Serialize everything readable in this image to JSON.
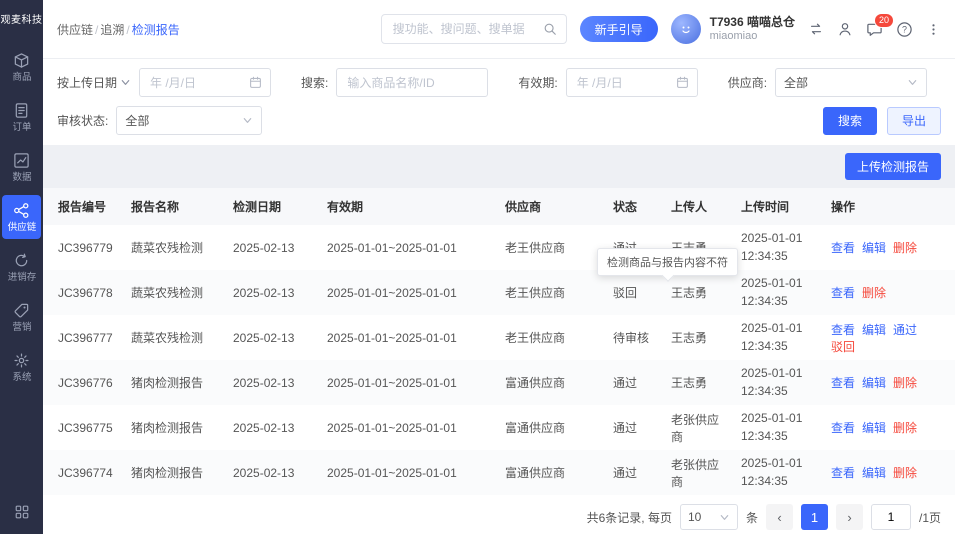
{
  "brand": {
    "logo": "观麦科技"
  },
  "colors": {
    "accent": "#3a66fb",
    "danger": "#f5483b",
    "sidebar_bg": "#2a2f45"
  },
  "sidebar": {
    "items": [
      {
        "name": "goods",
        "icon": "box",
        "label": "商品",
        "active": false
      },
      {
        "name": "orders",
        "icon": "file",
        "label": "订单",
        "active": false
      },
      {
        "name": "data",
        "icon": "chart",
        "label": "数据",
        "active": false
      },
      {
        "name": "supply-chain",
        "icon": "nodes",
        "label": "供应链",
        "active": true
      },
      {
        "name": "inventory",
        "icon": "cycle",
        "label": "进销存",
        "active": false
      },
      {
        "name": "marketing",
        "icon": "tag",
        "label": "营销",
        "active": false
      },
      {
        "name": "system",
        "icon": "gear",
        "label": "系统",
        "active": false
      }
    ]
  },
  "header": {
    "breadcrumb": [
      "供应链",
      "追溯",
      "检测报告"
    ],
    "search_placeholder": "搜功能、搜问题、搜单据",
    "guide_button": "新手引导",
    "account_name": "T7936 喵喵总仓",
    "account_sub": "miaomiao",
    "message_badge": "20"
  },
  "filters": {
    "date_field_label": "按上传日期",
    "date_placeholder": "年 /月/日",
    "search_label": "搜索:",
    "search_placeholder": "输入商品名称/ID",
    "validity_label": "有效期:",
    "validity_placeholder": "年 /月/日",
    "supplier_label": "供应商:",
    "supplier_value": "全部",
    "status_label": "审核状态:",
    "status_value": "全部",
    "search_button": "搜索",
    "export_button": "导出"
  },
  "toolbar": {
    "upload_button": "上传检测报告"
  },
  "tooltip": {
    "text": "检测商品与报告内容不符"
  },
  "table": {
    "headers": [
      "报告编号",
      "报告名称",
      "检测日期",
      "有效期",
      "供应商",
      "状态",
      "上传人",
      "上传时间",
      "操作"
    ],
    "rows": [
      {
        "id": "JC396779",
        "name": "蔬菜农残检测",
        "test_date": "2025-02-13",
        "validity": "2025-01-01~2025-01-01",
        "supplier": "老王供应商",
        "status": "通过",
        "uploader": "王志勇",
        "upload_time": "2025-01-01 12:34:35",
        "actions": [
          {
            "name": "view",
            "label": "查看",
            "type": "primary"
          },
          {
            "name": "edit",
            "label": "编辑",
            "type": "primary"
          },
          {
            "name": "delete",
            "label": "删除",
            "type": "danger"
          }
        ]
      },
      {
        "id": "JC396778",
        "name": "蔬菜农残检测",
        "test_date": "2025-02-13",
        "validity": "2025-01-01~2025-01-01",
        "supplier": "老王供应商",
        "status": "驳回",
        "uploader": "王志勇",
        "upload_time": "2025-01-01 12:34:35",
        "actions": [
          {
            "name": "view",
            "label": "查看",
            "type": "primary"
          },
          {
            "name": "delete",
            "label": "删除",
            "type": "danger"
          }
        ]
      },
      {
        "id": "JC396777",
        "name": "蔬菜农残检测",
        "test_date": "2025-02-13",
        "validity": "2025-01-01~2025-01-01",
        "supplier": "老王供应商",
        "status": "待审核",
        "uploader": "王志勇",
        "upload_time": "2025-01-01 12:34:35",
        "actions": [
          {
            "name": "view",
            "label": "查看",
            "type": "primary"
          },
          {
            "name": "edit",
            "label": "编辑",
            "type": "primary"
          },
          {
            "name": "approve",
            "label": "通过",
            "type": "primary"
          },
          {
            "name": "reject",
            "label": "驳回",
            "type": "danger"
          }
        ]
      },
      {
        "id": "JC396776",
        "name": "猪肉检测报告",
        "test_date": "2025-02-13",
        "validity": "2025-01-01~2025-01-01",
        "supplier": "富通供应商",
        "status": "通过",
        "uploader": "王志勇",
        "upload_time": "2025-01-01 12:34:35",
        "actions": [
          {
            "name": "view",
            "label": "查看",
            "type": "primary"
          },
          {
            "name": "edit",
            "label": "编辑",
            "type": "primary"
          },
          {
            "name": "delete",
            "label": "删除",
            "type": "danger"
          }
        ]
      },
      {
        "id": "JC396775",
        "name": "猪肉检测报告",
        "test_date": "2025-02-13",
        "validity": "2025-01-01~2025-01-01",
        "supplier": "富通供应商",
        "status": "通过",
        "uploader": "老张供应商",
        "upload_time": "2025-01-01 12:34:35",
        "actions": [
          {
            "name": "view",
            "label": "查看",
            "type": "primary"
          },
          {
            "name": "edit",
            "label": "编辑",
            "type": "primary"
          },
          {
            "name": "delete",
            "label": "删除",
            "type": "danger"
          }
        ]
      },
      {
        "id": "JC396774",
        "name": "猪肉检测报告",
        "test_date": "2025-02-13",
        "validity": "2025-01-01~2025-01-01",
        "supplier": "富通供应商",
        "status": "通过",
        "uploader": "老张供应商",
        "upload_time": "2025-01-01 12:34:35",
        "actions": [
          {
            "name": "view",
            "label": "查看",
            "type": "primary"
          },
          {
            "name": "edit",
            "label": "编辑",
            "type": "primary"
          },
          {
            "name": "delete",
            "label": "删除",
            "type": "danger"
          }
        ]
      }
    ]
  },
  "pagination": {
    "total_text": "共6条记录, 每页",
    "page_size": "10",
    "unit_text": "条",
    "prev_glyph": "‹",
    "next_glyph": "›",
    "current_page": "1",
    "page_input": "1",
    "total_pages_text": "/1页"
  }
}
